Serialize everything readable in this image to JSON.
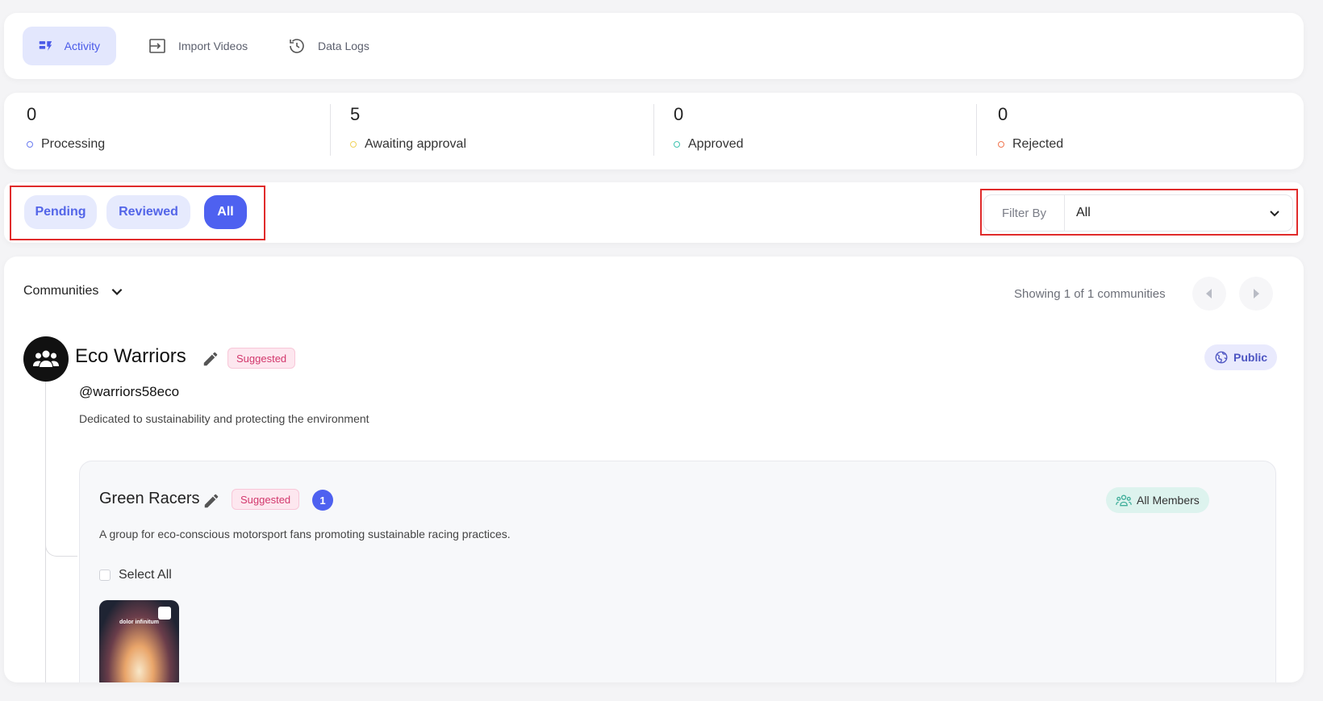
{
  "nav": {
    "tabs": [
      {
        "label": "Activity",
        "icon": "activity-icon",
        "active": true
      },
      {
        "label": "Import Videos",
        "icon": "import-icon",
        "active": false
      },
      {
        "label": "Data Logs",
        "icon": "history-icon",
        "active": false
      }
    ]
  },
  "stats": [
    {
      "value": "0",
      "label": "Processing",
      "color": "#6b7cf0"
    },
    {
      "value": "5",
      "label": "Awaiting approval",
      "color": "#f0d35a"
    },
    {
      "value": "0",
      "label": "Approved",
      "color": "#3fc3b0"
    },
    {
      "value": "0",
      "label": "Rejected",
      "color": "#f0764f"
    }
  ],
  "filters": {
    "pills": [
      "Pending",
      "Reviewed",
      "All"
    ],
    "active_pill": "All",
    "filter_by_label": "Filter By",
    "filter_by_value": "All"
  },
  "main": {
    "dropdown_label": "Communities",
    "showing": "Showing 1 of 1 communities",
    "community": {
      "name": "Eco Warriors",
      "badge": "Suggested",
      "visibility": "Public",
      "handle": "@warriors58eco",
      "description": "Dedicated to sustainability and protecting the environment"
    },
    "subgroup": {
      "name": "Green Racers",
      "badge": "Suggested",
      "count": "1",
      "audience": "All Members",
      "description": "A group for eco-conscious motorsport fans promoting sustainable racing practices.",
      "select_all": "Select All",
      "thumbnail_text": "dolor infinitum"
    }
  },
  "colors": {
    "accent": "#4e61f0",
    "highlight_box": "#e02b2b"
  }
}
